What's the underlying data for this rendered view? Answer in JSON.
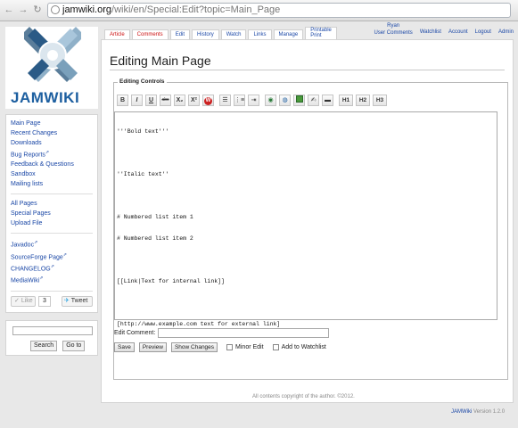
{
  "browser": {
    "url_host": "jamwiki.org",
    "url_path": "/wiki/en/Special:Edit?topic=Main_Page"
  },
  "logo": {
    "text": "JAMWIKI"
  },
  "sidebar": {
    "group1": [
      "Main Page",
      "Recent Changes",
      "Downloads",
      "Bug Reports",
      "Feedback & Questions",
      "Sandbox",
      "Mailing lists"
    ],
    "group2": [
      "All Pages",
      "Special Pages",
      "Upload File"
    ],
    "group3": [
      "Javadoc",
      "SourceForge Page",
      "CHANGELOG",
      "MediaWiki"
    ],
    "like_label": "Like",
    "like_count": "3",
    "tweet_label": "Tweet",
    "search_label": "Search",
    "goto_label": "Go to"
  },
  "tabs": [
    {
      "label": "Article"
    },
    {
      "label": "Comments"
    },
    {
      "label": "Edit"
    },
    {
      "label": "History"
    },
    {
      "label": "Watch"
    },
    {
      "label": "Links"
    },
    {
      "label": "Manage"
    },
    {
      "label1": "Printable",
      "label2": "Print"
    }
  ],
  "usernav": {
    "ryan": "Ryan",
    "user_comments": "User Comments",
    "watchlist": "Watchlist",
    "account": "Account",
    "logout": "Logout",
    "admin": "Admin"
  },
  "main": {
    "title": "Editing Main Page",
    "controls_legend": "Editing Controls",
    "toolbar": {
      "bold": "B",
      "italic": "I",
      "underline": "U",
      "strike": "abc",
      "sub": "X₂",
      "sup": "X²",
      "h1": "H1",
      "h2": "H2",
      "h3": "H3"
    },
    "text_lines": [
      "'''Bold text'''",
      "",
      "''Italic text''",
      "",
      "# Numbered list item 1",
      "# Numbered list item 2",
      "",
      "[[Link|Text for internal link]]",
      "",
      "[http://www.example.com text for external link]"
    ],
    "edit_comment_label": "Edit Comment:",
    "save": "Save",
    "preview": "Preview",
    "show_changes": "Show Changes",
    "minor_edit": "Minor Edit",
    "add_watchlist": "Add to Watchlist"
  },
  "footer": {
    "copyright": "All contents copyright of the author. ©2012.",
    "version_app": "JAMWiki",
    "version_text": "Version 1.2.0"
  }
}
